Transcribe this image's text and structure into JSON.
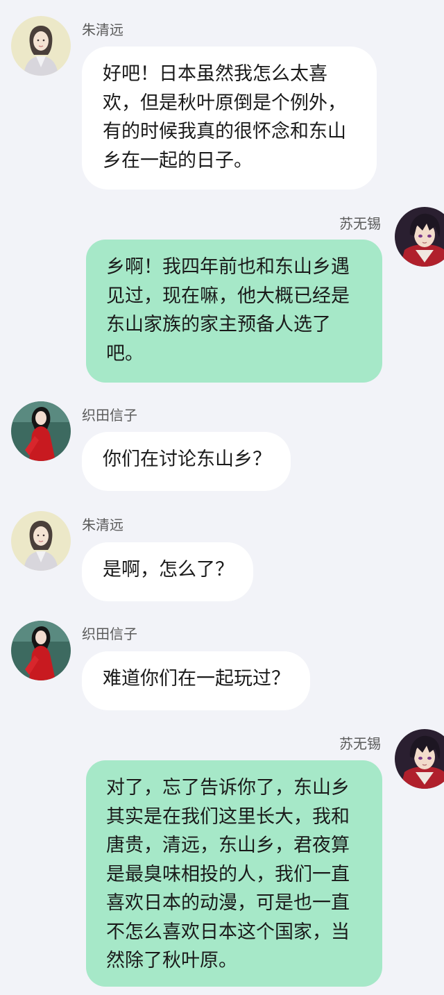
{
  "messages": [
    {
      "sender": "朱清远",
      "side": "left",
      "avatar": "girl-illustration-avatar",
      "lines": [
        "好吧！日本虽然我怎么太喜",
        "欢，但是秋叶原倒是个例外，",
        "有的时候我真的很怀念和东山",
        "乡在一起的日子。"
      ]
    },
    {
      "sender": "苏无锡",
      "side": "right",
      "avatar": "anime-boy-avatar",
      "lines": [
        "乡啊！我四年前也和东山乡遇",
        "见过，现在嘛，他大概已经是",
        "东山家族的家主预备人选了",
        "吧。"
      ]
    },
    {
      "sender": "织田信子",
      "side": "left",
      "avatar": "red-dress-woman-avatar",
      "lines": [
        "你们在讨论东山乡？"
      ]
    },
    {
      "sender": "朱清远",
      "side": "left",
      "avatar": "girl-illustration-avatar",
      "lines": [
        "是啊，怎么了？"
      ]
    },
    {
      "sender": "织田信子",
      "side": "left",
      "avatar": "red-dress-woman-avatar",
      "lines": [
        "难道你们在一起玩过？"
      ]
    },
    {
      "sender": "苏无锡",
      "side": "right",
      "avatar": "anime-boy-avatar",
      "lines": [
        "对了，忘了告诉你了，东山乡",
        "其实是在我们这里长大，我和",
        "唐贵，清远，东山乡，君夜算",
        "是最臭味相投的人，我们一直",
        "喜欢日本的动漫，可是也一直",
        "不怎么喜欢日本这个国家，当",
        "然除了秋叶原。"
      ]
    }
  ]
}
